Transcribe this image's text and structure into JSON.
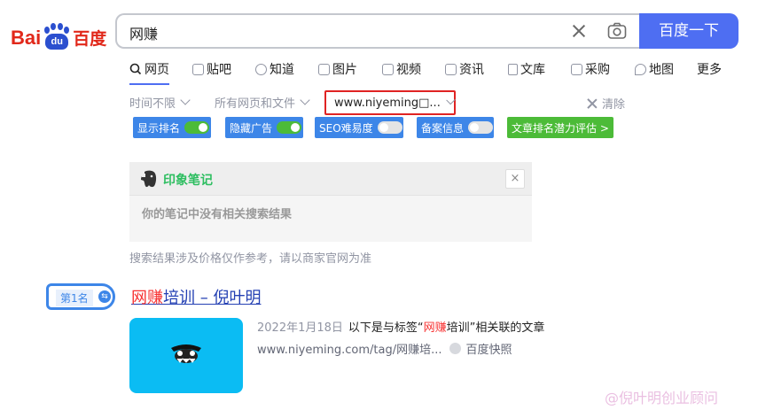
{
  "logo": {
    "bai": "Bai",
    "du": "du",
    "cn": "百度"
  },
  "search": {
    "query": "网赚",
    "button": "百度一下"
  },
  "tabs": [
    {
      "label": "网页"
    },
    {
      "label": "贴吧"
    },
    {
      "label": "知道"
    },
    {
      "label": "图片"
    },
    {
      "label": "视频"
    },
    {
      "label": "资讯"
    },
    {
      "label": "文库"
    },
    {
      "label": "采购"
    },
    {
      "label": "地图"
    },
    {
      "label": "更多"
    }
  ],
  "filters": {
    "time": "时间不限",
    "type": "所有网页和文件",
    "site": "www.niyeming□...",
    "clear": "清除"
  },
  "plugin": {
    "show_rank": "显示排名",
    "hide_ads": "隐藏广告",
    "seo": "SEO难易度",
    "beian": "备案信息",
    "evaluate": "文章排名潜力评估 >"
  },
  "note": {
    "title": "印象笔记",
    "empty": "你的笔记中没有相关搜索结果",
    "close": "×"
  },
  "disclaimer": "搜索结果涉及价格仅作参考，请以商家官网为准",
  "result": {
    "rank": "第1名",
    "title_hl": "网赚",
    "title_rest": "培训 – 倪叶明",
    "date": "2022年1月18日",
    "desc_pre": "以下是与标签“",
    "desc_hl": "网赚",
    "desc_post": "培训”相关联的文章",
    "url": "www.niyeming.com/tag/网赚培...",
    "snapshot": "百度快照"
  },
  "watermark": "@倪叶明创业顾问"
}
